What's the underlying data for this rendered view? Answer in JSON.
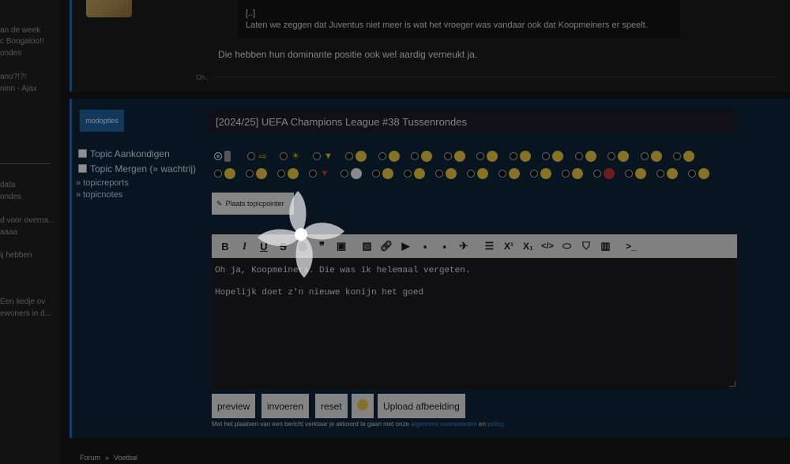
{
  "sidebar": {
    "items": [
      {
        "text": "an de week"
      },
      {
        "text": "c Boogaloo!!"
      },
      {
        "text": "ondes"
      },
      {
        "text": "ano?!?!"
      },
      {
        "text": "nion - Ajax"
      },
      {
        "text": "data"
      },
      {
        "text": "ondes"
      },
      {
        "text": "d voor overna..."
      },
      {
        "text": "aaaa"
      },
      {
        "text": "ij hebben"
      },
      {
        "text": "Een liedje ov"
      },
      {
        "text": "ewoners in d..."
      }
    ]
  },
  "top_post": {
    "quote_ellipsis": "[..]",
    "quote_text": "Laten we zeggen dat Juventus niet meer is wat het vroeger was vandaar ook dat Koopmeiners er speelt.",
    "body": "Die hebben hun dominante positie ook wel aardig verneukt ja.",
    "meta": "Oh."
  },
  "mod": {
    "button_label": "modopties",
    "checkbox_1": "Topic Aankondigen",
    "checkbox_2": "Topic Mergen (» wachtrij)",
    "link_1": "» topicreports",
    "link_2": "» topicnotes"
  },
  "reply": {
    "title_value": "[2024/25] UEFA Champions League #38 Tussenrondes",
    "topicpointer_label": "Plaats topicpointer",
    "editor_line_1": "Oh ja, Koopmeiners. Die was ik helemaal vergeten.",
    "editor_line_2": "Hopelijk doet z'n nieuwe konijn het goed",
    "buttons": {
      "preview": "preview",
      "invoeren": "invoeren",
      "reset": "reset",
      "upload": "Upload afbeelding"
    },
    "disclaimer_pre": "Met het plaatsen van een bericht verklaar je akkoord te gaan met onze",
    "disclaimer_link_1": "algemene voorwaarden",
    "disclaimer_mid": "en",
    "disclaimer_link_2": "policy",
    "disclaimer_end": "."
  },
  "toolbar": {
    "bold": "B",
    "italic": "I",
    "underline": "U",
    "strike": "S",
    "superscript": "X¹",
    "subscript": "X₁",
    "code": "</>",
    "terminal": ">_"
  },
  "breadcrumb": {
    "forum": "Forum",
    "sep": "»",
    "voetbal": "Voetbal"
  },
  "colors": {
    "accent": "#2b63a8",
    "reply_bg": "#0e2236",
    "link": "#3a7cc4"
  }
}
